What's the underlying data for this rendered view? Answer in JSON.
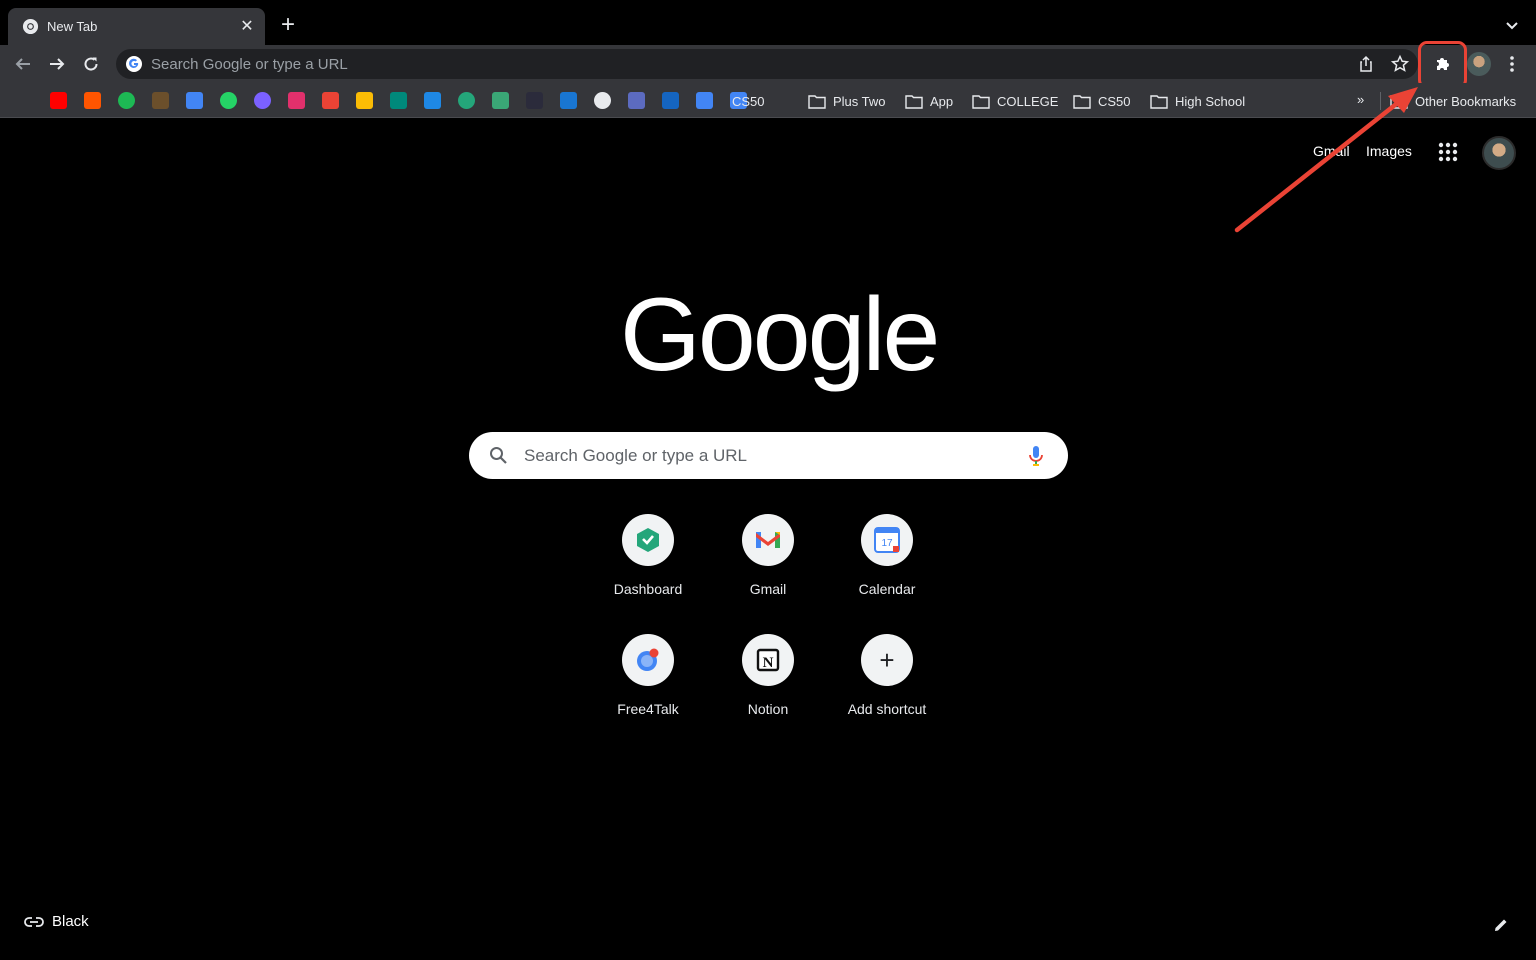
{
  "tab": {
    "title": "New Tab",
    "close": "✕",
    "new_tab": "+"
  },
  "omnibox": {
    "placeholder": "Search Google or type a URL"
  },
  "bookmarks": {
    "folders": [
      "CS50",
      "Plus Two",
      "App",
      "COLLEGE",
      "CS50",
      "High School"
    ],
    "more": "»",
    "other": "Other Bookmarks",
    "icons": [
      "netflix-icon",
      "youtube-icon",
      "soundcloud-icon",
      "spotify-icon",
      "app-icon",
      "calendar-icon",
      "whatsapp-icon",
      "messenger-icon",
      "instagram-icon",
      "gmail-icon",
      "pinwheel-icon",
      "meet-icon",
      "chat-icon",
      "dashboard-icon",
      "d-icon",
      "code-icon",
      "drop-icon",
      "clock-icon",
      "list-icon",
      "tt-icon",
      "gs-icon",
      "docs-icon"
    ],
    "colors": [
      "#e50914",
      "#ff0000",
      "#ff5500",
      "#1db954",
      "#6b4f2b",
      "#4285f4",
      "#25d366",
      "#7b61ff",
      "#e1306c",
      "#ea4335",
      "#fbbc05",
      "#00897b",
      "#1e88e5",
      "#24a67a",
      "#3aa776",
      "#2b2b3b",
      "#1976d2",
      "#e8eaed",
      "#5c6bc0",
      "#1565c0",
      "#4285f4",
      "#4285f4"
    ]
  },
  "header": {
    "gmail": "Gmail",
    "images": "Images"
  },
  "logo": "Google",
  "search": {
    "placeholder": "Search Google or type a URL"
  },
  "shortcuts": [
    {
      "label": "Dashboard",
      "icon": "dashboard-icon"
    },
    {
      "label": "Gmail",
      "icon": "gmail-icon"
    },
    {
      "label": "Calendar",
      "icon": "calendar-icon",
      "badge": "17"
    },
    {
      "label": "Free4Talk",
      "icon": "free4talk-icon"
    },
    {
      "label": "Notion",
      "icon": "notion-icon",
      "badge": "N"
    },
    {
      "label": "Add shortcut",
      "icon": "plus-icon",
      "badge": "+"
    }
  ],
  "footer": {
    "theme_label": "Black"
  },
  "accent": {
    "annotation": "#ea4335",
    "toolbar_bg": "#35363a",
    "page_bg": "#000000"
  }
}
